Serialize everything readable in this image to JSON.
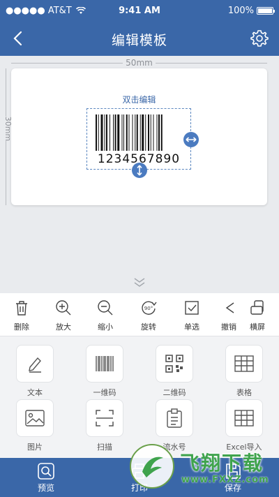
{
  "status_bar": {
    "carrier": "●●●●● AT&T",
    "time": "9:41 AM",
    "battery": "100%"
  },
  "nav": {
    "title": "编辑模板",
    "back_icon": "chevron-left-icon",
    "settings_icon": "gear-icon"
  },
  "canvas": {
    "width_label": "50mm",
    "height_label": "30mm",
    "hint": "双击编辑",
    "barcode_value": "1234567890"
  },
  "toolbar": [
    {
      "label": "删除",
      "icon": "trash-icon"
    },
    {
      "label": "放大",
      "icon": "zoom-in-icon"
    },
    {
      "label": "缩小",
      "icon": "zoom-out-icon"
    },
    {
      "label": "旋转",
      "icon": "rotate-icon",
      "badge": "90°"
    },
    {
      "label": "单选",
      "icon": "checkbox-icon"
    },
    {
      "label": "撤销",
      "icon": "undo-icon"
    },
    {
      "label": "横屏",
      "icon": "landscape-icon"
    }
  ],
  "elements": [
    {
      "label": "文本",
      "icon": "text-pen-icon"
    },
    {
      "label": "一维码",
      "icon": "barcode-icon"
    },
    {
      "label": "二维码",
      "icon": "qrcode-icon"
    },
    {
      "label": "表格",
      "icon": "table-icon"
    },
    {
      "label": "图片",
      "icon": "image-icon"
    },
    {
      "label": "扫描",
      "icon": "scan-icon"
    },
    {
      "label": "流水号",
      "icon": "clipboard-icon"
    },
    {
      "label": "Excel导入",
      "icon": "excel-table-icon"
    }
  ],
  "bottom_tabs": [
    {
      "label": "预览",
      "icon": "preview-icon"
    },
    {
      "label": "打印",
      "icon": "print-icon"
    },
    {
      "label": "保存",
      "icon": "save-icon"
    }
  ],
  "watermark": {
    "title": "飞翔下载",
    "url": "www.FXXZ.com"
  },
  "colors": {
    "primary": "#3a67a8",
    "accent": "#4b7bc0",
    "watermark_green": "#3fa34d"
  }
}
